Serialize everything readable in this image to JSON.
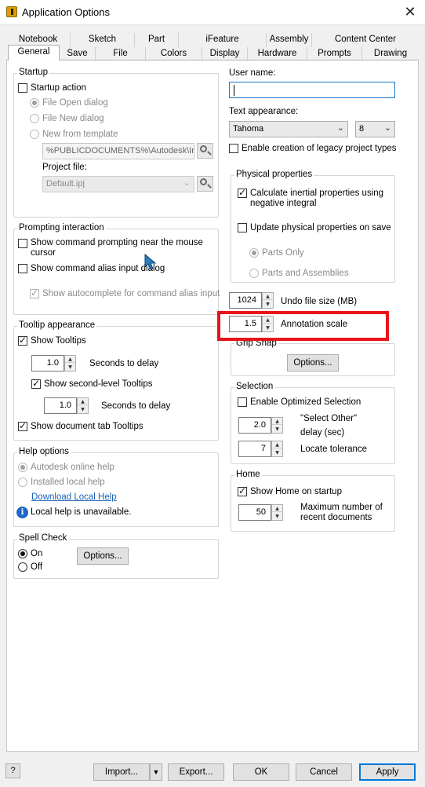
{
  "window": {
    "title": "Application Options",
    "close_glyph": "✕"
  },
  "tabs": {
    "row1": [
      "Notebook",
      "Sketch",
      "Part",
      "iFeature",
      "Assembly",
      "Content Center"
    ],
    "row2": [
      "General",
      "Save",
      "File",
      "Colors",
      "Display",
      "Hardware",
      "Prompts",
      "Drawing"
    ],
    "selected": "General"
  },
  "startup": {
    "group_label": "Startup",
    "startup_action_label": "Startup action",
    "startup_action_checked": false,
    "file_open_label": "File Open dialog",
    "file_new_label": "File New dialog",
    "new_from_template_label": "New from template",
    "selected_option": "File Open dialog",
    "template_path": "%PUBLICDOCUMENTS%\\Autodesk\\Inv",
    "project_file_label": "Project file:",
    "project_file_value": "Default.ipj"
  },
  "prompting": {
    "group_label": "Prompting interaction",
    "near_mouse_label": "Show command prompting near the mouse cursor",
    "near_mouse_line1": "Show command prompting near the mouse",
    "near_mouse_line2": "cursor",
    "near_mouse_checked": false,
    "alias_input_label": "Show command alias input dialog",
    "alias_input_checked": false,
    "autocomplete_label": "Show autocomplete for command alias input",
    "autocomplete_checked": true
  },
  "tooltip": {
    "group_label": "Tooltip appearance",
    "show_tooltips_label": "Show Tooltips",
    "show_tooltips_checked": true,
    "delay_value": "1.0",
    "seconds_to_delay_label": "Seconds to delay",
    "second_level_label": "Show second-level Tooltips",
    "second_level_checked": true,
    "second_delay_value": "1.0",
    "second_seconds_label": "Seconds to delay",
    "doc_tab_label": "Show document tab Tooltips",
    "doc_tab_checked": true
  },
  "help": {
    "group_label": "Help options",
    "online_label": "Autodesk online help",
    "local_label": "Installed local help",
    "selected_option": "Autodesk online help",
    "download_link": "Download Local Help",
    "unavailable_text": "Local help is unavailable."
  },
  "spell": {
    "group_label": "Spell Check",
    "on_label": "On",
    "off_label": "Off",
    "selected_option": "On",
    "options_button": "Options..."
  },
  "user": {
    "label": "User name:",
    "value": ""
  },
  "text_appearance": {
    "label": "Text appearance:",
    "font": "Tahoma",
    "size": "8"
  },
  "legacy": {
    "label": "Enable creation of legacy project types",
    "checked": false
  },
  "physical": {
    "group_label": "Physical properties",
    "inertial_line1": "Calculate inertial properties using",
    "inertial_line2": "negative integral",
    "inertial_checked": true,
    "update_label": "Update physical properties on save",
    "update_checked": false,
    "parts_only_label": "Parts Only",
    "parts_assemblies_label": "Parts and Assemblies",
    "selected_option": "Parts Only"
  },
  "undo": {
    "value": "1024",
    "label": "Undo file size (MB)"
  },
  "annotation": {
    "value": "1.5",
    "label": "Annotation scale"
  },
  "grip": {
    "group_label": "Grip Snap",
    "options_button": "Options..."
  },
  "selection": {
    "group_label": "Selection",
    "optimized_label": "Enable Optimized Selection",
    "optimized_checked": false,
    "select_other_value": "2.0",
    "select_other_line1": "\"Select Other\"",
    "select_other_line2": "delay (sec)",
    "locate_value": "7",
    "locate_label": "Locate tolerance"
  },
  "home": {
    "group_label": "Home",
    "show_home_label": "Show Home on startup",
    "show_home_checked": true,
    "max_value": "50",
    "max_line1": "Maximum number of",
    "max_line2": "recent documents"
  },
  "footer": {
    "help_glyph": "?",
    "import_label": "Import...",
    "export_label": "Export...",
    "ok_label": "OK",
    "cancel_label": "Cancel",
    "apply_label": "Apply"
  },
  "colors": {
    "highlight": "#e8141a",
    "link": "#1a5fb4",
    "accent": "#0078d7",
    "info": "#1c68c6"
  }
}
